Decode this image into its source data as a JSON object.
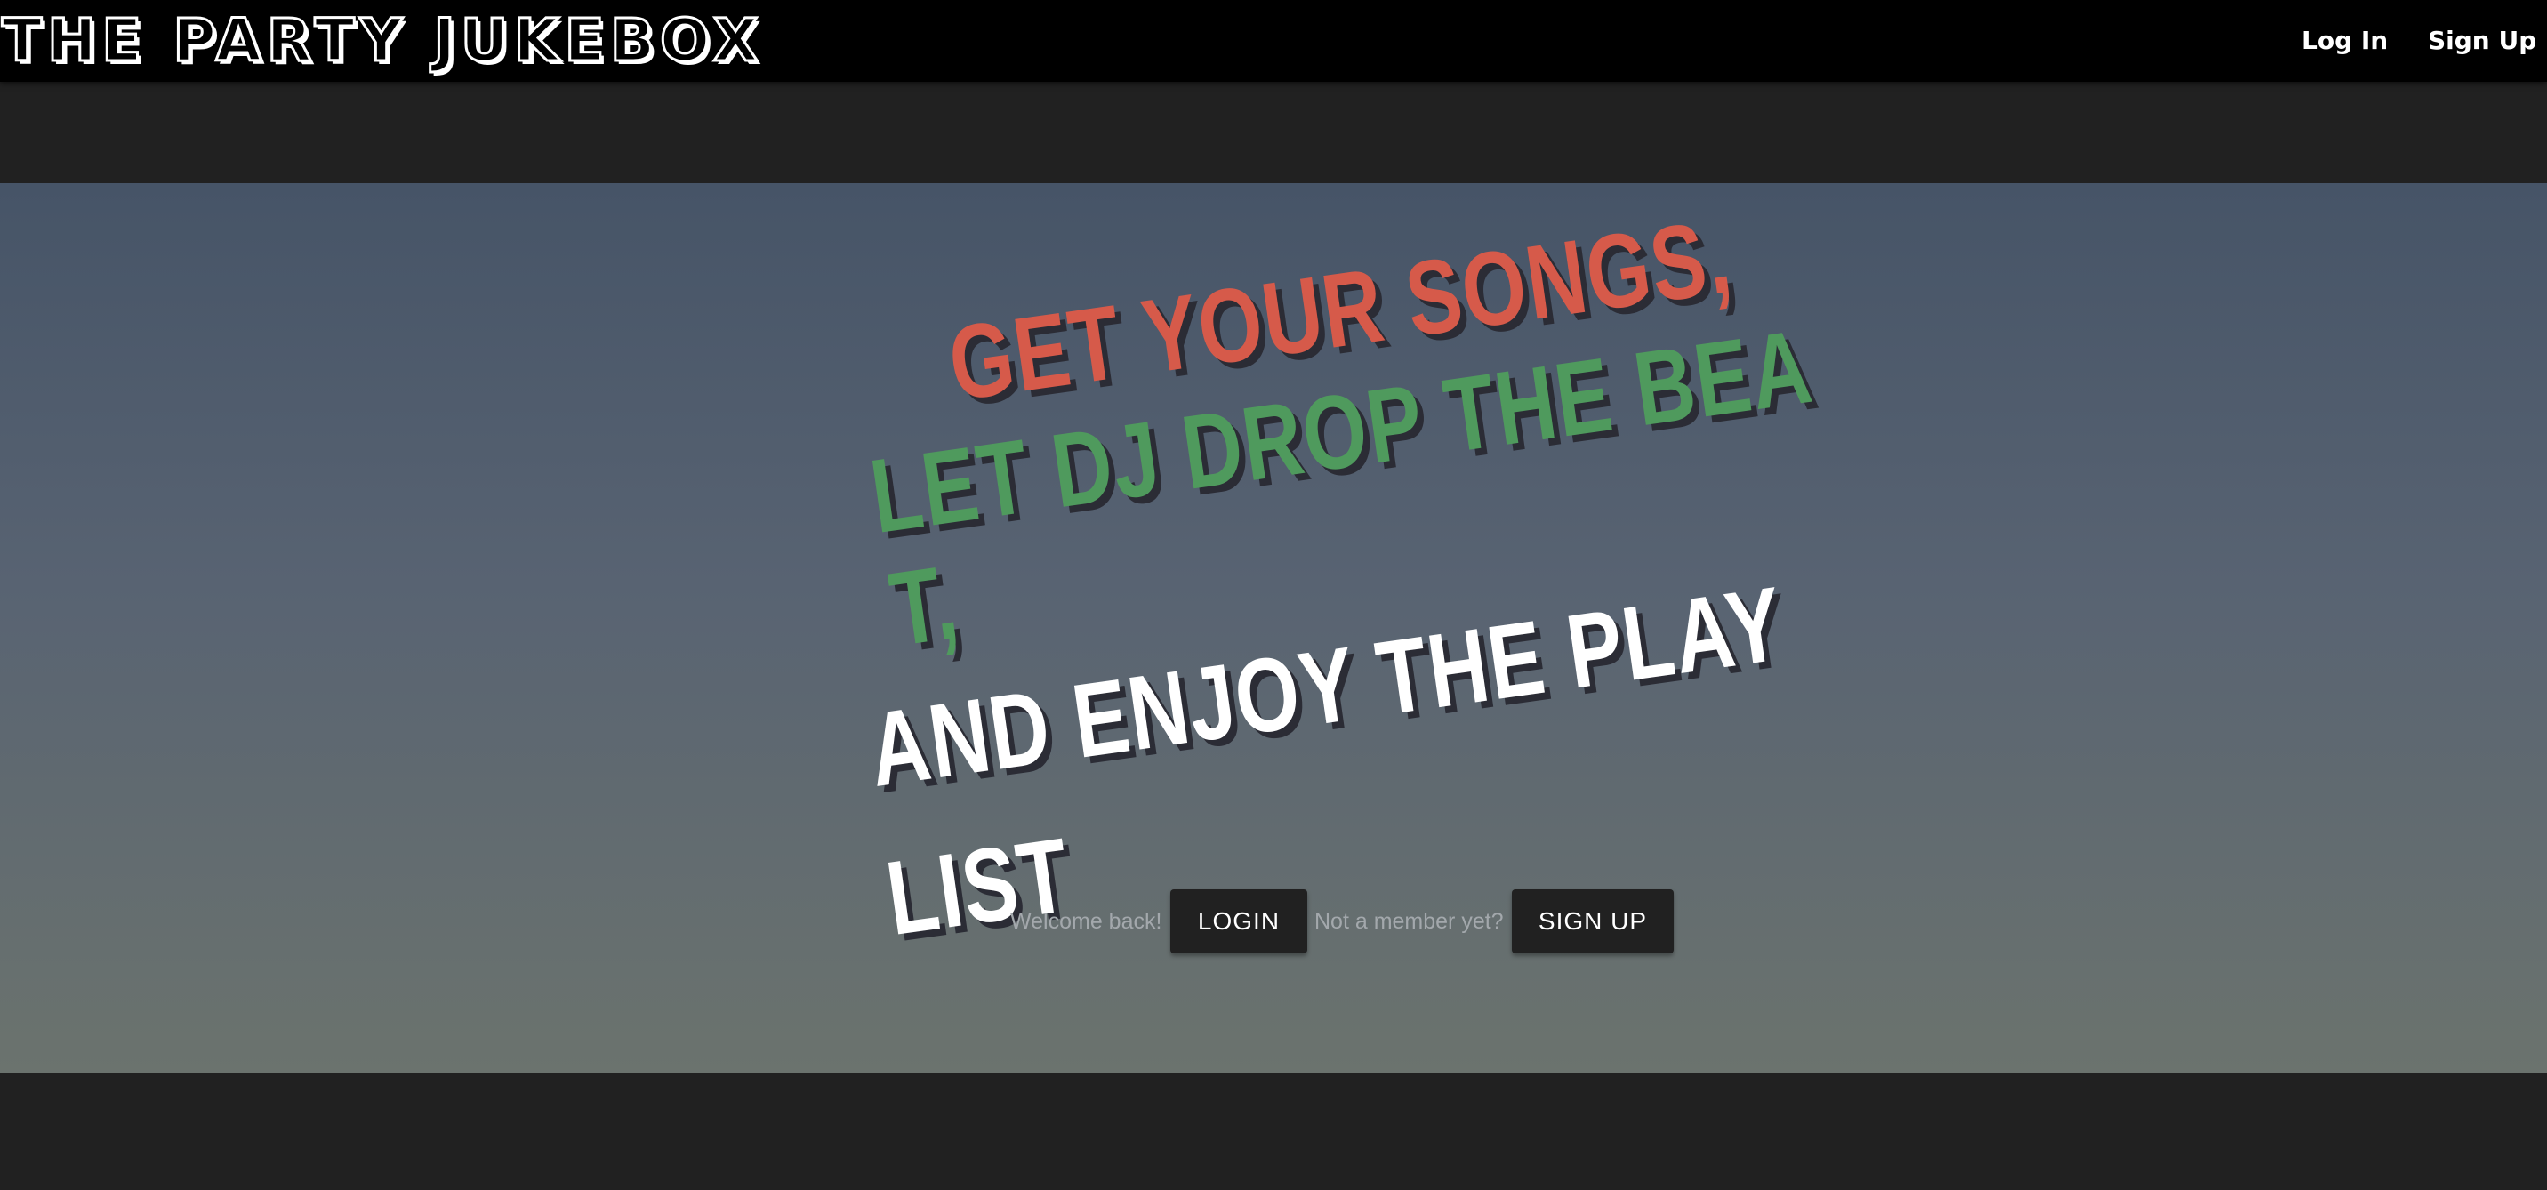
{
  "header": {
    "brand": "THE PARTY JUKEBOX",
    "nav": {
      "login": "Log In",
      "signup": "Sign Up"
    }
  },
  "hero": {
    "headline": {
      "line1": "GET YOUR SONGS,",
      "line2": "LET DJ DROP THE BEA",
      "line3": "T,",
      "line4": "AND ENJOY THE PLAY",
      "line5": "LIST"
    },
    "cta": {
      "welcome_text": "Welcome back!",
      "login_button": "LOGIN",
      "member_text": "Not a member yet?",
      "signup_button": "SIGN UP"
    }
  },
  "colors": {
    "topbar": "#000000",
    "page_background": "#212121",
    "hero_gradient_top": "#465467",
    "hero_gradient_bottom": "#6b736e",
    "headline_red": "#d65a4a",
    "headline_green": "#4f9a5d",
    "headline_white": "#ffffff",
    "button_background": "#212121"
  }
}
